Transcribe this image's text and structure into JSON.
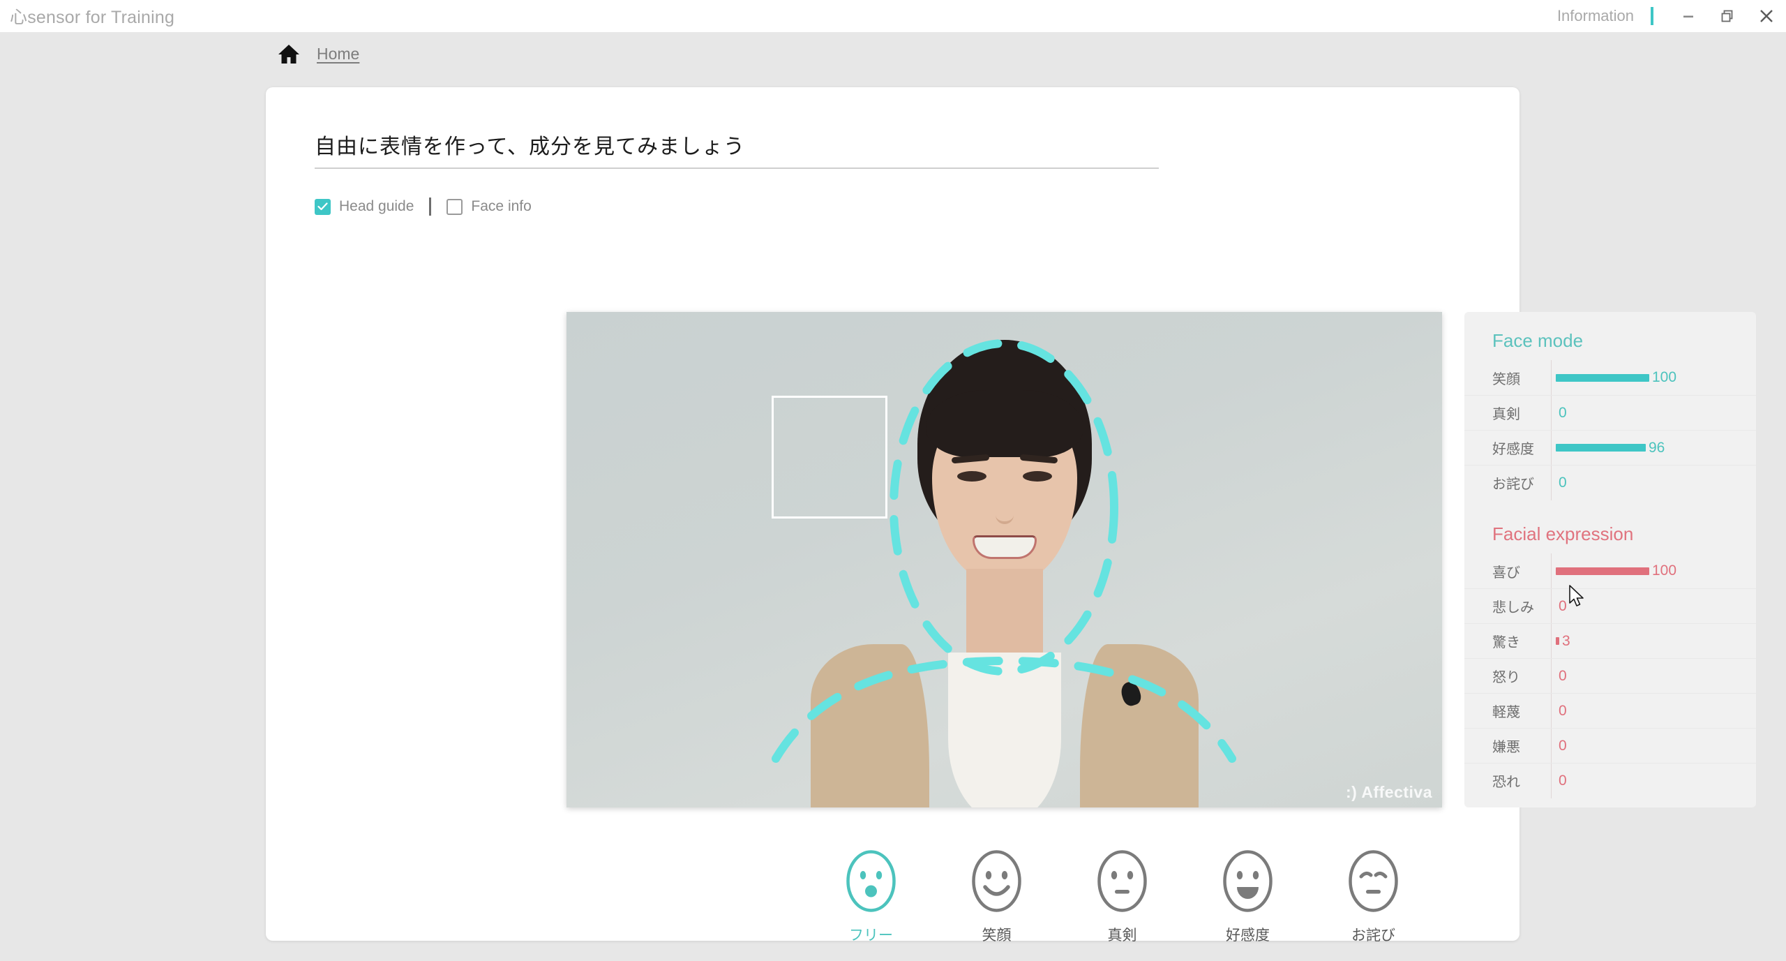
{
  "window": {
    "app_title": "心sensor for Training",
    "information_label": "Information",
    "minimize_icon": "minimize-icon",
    "restore_icon": "restore-icon",
    "close_icon": "close-icon",
    "accent_color": "#3ec6c6"
  },
  "breadcrumb": {
    "home_icon": "home-icon",
    "home_label": "Home"
  },
  "main": {
    "page_title": "自由に表情を作って、成分を見てみましょう",
    "options": [
      {
        "label": "Head guide",
        "checked": true
      },
      {
        "label": "Face info",
        "checked": false
      }
    ],
    "video": {
      "watermark": ":) Affectiva",
      "head_guide_visible": true,
      "face_box_visible": true
    }
  },
  "results": {
    "face_mode": {
      "title": "Face mode",
      "color": "#5cc2bd",
      "metrics": [
        {
          "label": "笑顔",
          "value": 100
        },
        {
          "label": "真剣",
          "value": 0
        },
        {
          "label": "好感度",
          "value": 96
        },
        {
          "label": "お詫び",
          "value": 0
        }
      ]
    },
    "facial_expression": {
      "title": "Facial expression",
      "color": "#e0737e",
      "metrics": [
        {
          "label": "喜び",
          "value": 100
        },
        {
          "label": "悲しみ",
          "value": 0
        },
        {
          "label": "驚き",
          "value": 3
        },
        {
          "label": "怒り",
          "value": 0
        },
        {
          "label": "軽蔑",
          "value": 0
        },
        {
          "label": "嫌悪",
          "value": 0
        },
        {
          "label": "恐れ",
          "value": 0
        }
      ]
    }
  },
  "modes": [
    {
      "label": "フリー",
      "icon": "face-surprised-icon",
      "active": true
    },
    {
      "label": "笑顔",
      "icon": "face-smile-icon",
      "active": false
    },
    {
      "label": "真剣",
      "icon": "face-neutral-icon",
      "active": false
    },
    {
      "label": "好感度",
      "icon": "face-open-smile-icon",
      "active": false
    },
    {
      "label": "お詫び",
      "icon": "face-apology-icon",
      "active": false
    }
  ]
}
